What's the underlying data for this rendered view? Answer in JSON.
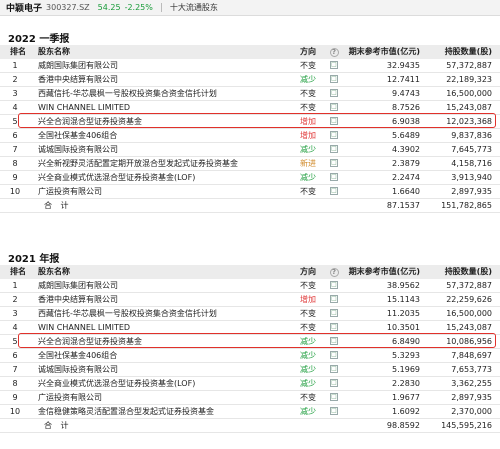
{
  "header": {
    "stock_name": "中颖电子",
    "stock_code": "300327.SZ",
    "price": "54.25",
    "change_pct": "-2.25%",
    "tab_label": "十大流通股东"
  },
  "columns": {
    "rank": "排名",
    "name": "股东名称",
    "direction": "方向",
    "help": "?",
    "value": "期末参考市值(亿元)",
    "shares": "持股数量(股)"
  },
  "detail_icon": "detail-box-icon",
  "colors": {
    "increase": "#e03a3a",
    "decrease": "#1a9c3a",
    "new": "#d08a2a",
    "highlight_border": "#e0312b"
  },
  "sections": [
    {
      "title": "2022 一季报",
      "rows": [
        {
          "rank": "1",
          "name": "威朗国际集团有限公司",
          "dir": "不变",
          "dir_type": "black",
          "value": "32.9435",
          "shares": "57,372,887"
        },
        {
          "rank": "2",
          "name": "香港中央结算有限公司",
          "dir": "减少",
          "dir_type": "green",
          "value": "12.7411",
          "shares": "22,189,323"
        },
        {
          "rank": "3",
          "name": "西藏信托-华芯晨枫一号股权投资集合资金信托计划",
          "dir": "不变",
          "dir_type": "black",
          "value": "9.4743",
          "shares": "16,500,000"
        },
        {
          "rank": "4",
          "name": "WIN CHANNEL LIMITED",
          "dir": "不变",
          "dir_type": "black",
          "value": "8.7526",
          "shares": "15,243,087"
        },
        {
          "rank": "5",
          "name": "兴全合润混合型证券投资基金",
          "dir": "增加",
          "dir_type": "red",
          "value": "6.9038",
          "shares": "12,023,368",
          "highlight": true
        },
        {
          "rank": "6",
          "name": "全国社保基金406组合",
          "dir": "增加",
          "dir_type": "red",
          "value": "5.6489",
          "shares": "9,837,836"
        },
        {
          "rank": "7",
          "name": "诚城国际投资有限公司",
          "dir": "减少",
          "dir_type": "green",
          "value": "4.3902",
          "shares": "7,645,773"
        },
        {
          "rank": "8",
          "name": "兴全新视野灵活配置定期开放混合型发起式证券投资基金",
          "dir": "新进",
          "dir_type": "orange",
          "value": "2.3879",
          "shares": "4,158,716"
        },
        {
          "rank": "9",
          "name": "兴全商业模式优选混合型证券投资基金(LOF)",
          "dir": "减少",
          "dir_type": "green",
          "value": "2.2474",
          "shares": "3,913,940"
        },
        {
          "rank": "10",
          "name": "广运投资有限公司",
          "dir": "不变",
          "dir_type": "black",
          "value": "1.6640",
          "shares": "2,897,935"
        }
      ],
      "total": {
        "label": "合 计",
        "value": "87.1537",
        "shares": "151,782,865"
      }
    },
    {
      "title": "2021 年报",
      "rows": [
        {
          "rank": "1",
          "name": "威朗国际集团有限公司",
          "dir": "不变",
          "dir_type": "black",
          "value": "38.9562",
          "shares": "57,372,887"
        },
        {
          "rank": "2",
          "name": "香港中央结算有限公司",
          "dir": "增加",
          "dir_type": "red",
          "value": "15.1143",
          "shares": "22,259,626"
        },
        {
          "rank": "3",
          "name": "西藏信托-华芯晨枫一号股权投资集合资金信托计划",
          "dir": "不变",
          "dir_type": "black",
          "value": "11.2035",
          "shares": "16,500,000"
        },
        {
          "rank": "4",
          "name": "WIN CHANNEL LIMITED",
          "dir": "不变",
          "dir_type": "black",
          "value": "10.3501",
          "shares": "15,243,087"
        },
        {
          "rank": "5",
          "name": "兴全合润混合型证券投资基金",
          "dir": "减少",
          "dir_type": "green",
          "value": "6.8490",
          "shares": "10,086,956",
          "highlight": true
        },
        {
          "rank": "6",
          "name": "全国社保基金406组合",
          "dir": "减少",
          "dir_type": "green",
          "value": "5.3293",
          "shares": "7,848,697"
        },
        {
          "rank": "7",
          "name": "诚城国际投资有限公司",
          "dir": "减少",
          "dir_type": "green",
          "value": "5.1969",
          "shares": "7,653,773"
        },
        {
          "rank": "8",
          "name": "兴全商业模式优选混合型证券投资基金(LOF)",
          "dir": "减少",
          "dir_type": "green",
          "value": "2.2830",
          "shares": "3,362,255"
        },
        {
          "rank": "9",
          "name": "广运投资有限公司",
          "dir": "不变",
          "dir_type": "black",
          "value": "1.9677",
          "shares": "2,897,935"
        },
        {
          "rank": "10",
          "name": "金信稳健策略灵活配置混合型发起式证券投资基金",
          "dir": "减少",
          "dir_type": "green",
          "value": "1.6092",
          "shares": "2,370,000"
        }
      ],
      "total": {
        "label": "合 计",
        "value": "98.8592",
        "shares": "145,595,216"
      }
    }
  ]
}
